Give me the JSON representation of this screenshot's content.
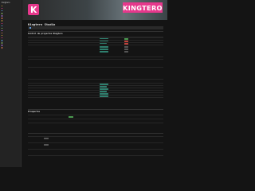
{
  "sidebar": {
    "title": "Kingtero",
    "items": [
      "",
      "",
      "",
      "",
      "",
      "",
      "",
      "",
      "",
      "",
      "",
      "",
      "",
      "",
      "",
      "",
      "",
      ""
    ],
    "sub_title": "",
    "note": ""
  },
  "banner": {
    "brand": "KINGTERO",
    "logo": "k-logo-icon"
  },
  "page": {
    "title": "Kingtero Studio",
    "notice": ""
  },
  "section1": {
    "label": "",
    "title": "Control de proyectos Kingtero",
    "columns": [
      "",
      "",
      "",
      "",
      "",
      "",
      "",
      ""
    ]
  },
  "section2": {
    "label": "",
    "title": "Prospectos"
  },
  "section3": {
    "label": "",
    "title": ""
  },
  "colors": {
    "accent": "#e6388c",
    "teal": "#2f7f6e",
    "green": "#4b9a50",
    "red": "#c0433c"
  }
}
